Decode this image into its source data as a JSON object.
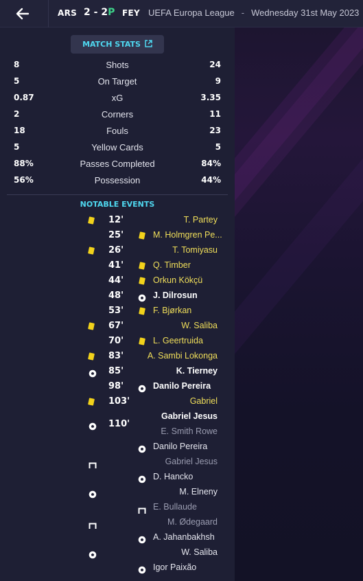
{
  "header": {
    "home_team": "ARS",
    "score_home": "2",
    "score_sep": "-",
    "score_away": "2",
    "penalties_marker": "P",
    "away_team": "FEY",
    "competition": "UEFA Europa League",
    "separator": "-",
    "date": "Wednesday 31st May 2023"
  },
  "match_stats_button": "MATCH STATS",
  "stats": [
    {
      "label": "Shots",
      "home": "8",
      "away": "24"
    },
    {
      "label": "On Target",
      "home": "5",
      "away": "9"
    },
    {
      "label": "xG",
      "home": "0.87",
      "away": "3.35"
    },
    {
      "label": "Corners",
      "home": "2",
      "away": "11"
    },
    {
      "label": "Fouls",
      "home": "18",
      "away": "23"
    },
    {
      "label": "Yellow Cards",
      "home": "5",
      "away": "5"
    },
    {
      "label": "Passes Completed",
      "home": "88%",
      "away": "84%"
    },
    {
      "label": "Possession",
      "home": "56%",
      "away": "44%"
    }
  ],
  "notable_events_title": "NOTABLE EVENTS",
  "events": {
    "e1": {
      "player": "T. Partey",
      "minute": "12'"
    },
    "e2": {
      "player": "M. Holmgren Pe...",
      "minute": "25'"
    },
    "e3": {
      "player": "T. Tomiyasu",
      "minute": "26'"
    },
    "e4": {
      "player": "Q. Timber",
      "minute": "41'"
    },
    "e5": {
      "player": "Orkun Kökçü",
      "minute": "44'"
    },
    "e6": {
      "player": "J. Dilrosun",
      "minute": "48'"
    },
    "e7": {
      "player": "F. Bjørkan",
      "minute": "53'"
    },
    "e8": {
      "player": "W. Saliba",
      "minute": "67'"
    },
    "e9": {
      "player": "L. Geertruida",
      "minute": "70'"
    },
    "e10": {
      "player": "A. Sambi Lokonga",
      "minute": "83'"
    },
    "e11": {
      "player": "K. Tierney",
      "minute": "85'"
    },
    "e12": {
      "player": "Danilo Pereira",
      "minute": "98'"
    },
    "e13": {
      "player": "Gabriel",
      "minute": "103'"
    },
    "e14": {
      "player": "Gabriel Jesus",
      "assist": "E. Smith Rowe",
      "minute": "110'"
    }
  },
  "penalties": {
    "p1": {
      "player": "Danilo Pereira"
    },
    "p2": {
      "player": "Gabriel Jesus"
    },
    "p3": {
      "player": "D. Hancko"
    },
    "p4": {
      "player": "M. Elneny"
    },
    "p5": {
      "player": "E. Bullaude"
    },
    "p6": {
      "player": "M. Ødegaard"
    },
    "p7": {
      "player": "A. Jahanbakhsh"
    },
    "p8": {
      "player": "W. Saliba"
    },
    "p9": {
      "player": "Igor Paixão"
    }
  },
  "colors": {
    "accent": "#4fd8f0",
    "yellow_card": "#f2d21b",
    "penalty_marker": "#3ed38a",
    "background": "#1e1f34"
  }
}
